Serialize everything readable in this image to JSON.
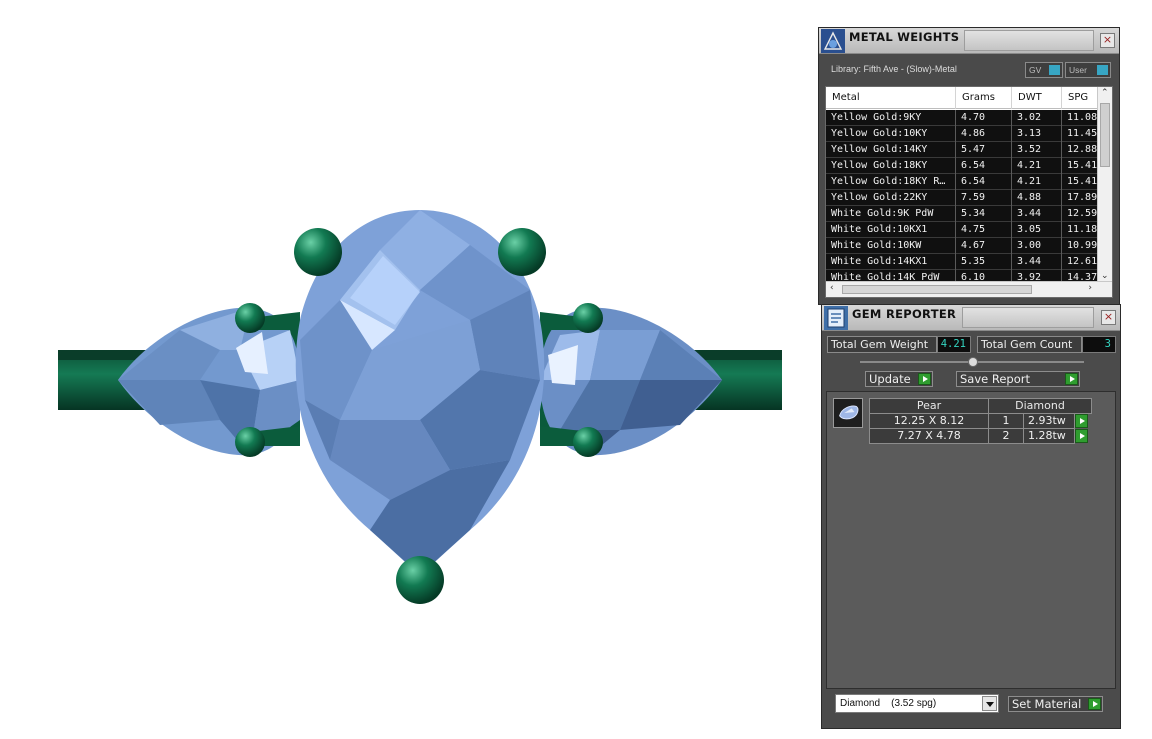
{
  "viewport": {
    "colors": {
      "gem": "#7fa2d8",
      "metal": "#0f6a48"
    }
  },
  "metal_weights": {
    "title": "METAL WEIGHTS",
    "library": "Library: Fifth Ave - (Slow)-Metal",
    "toggle_gv": "GV",
    "toggle_user": "User",
    "columns": [
      "Metal",
      "Grams",
      "DWT",
      "SPG"
    ],
    "rows": [
      [
        "Yellow Gold:9KY",
        "4.70",
        "3.02",
        "11.08"
      ],
      [
        "Yellow Gold:10KY",
        "4.86",
        "3.13",
        "11.45"
      ],
      [
        "Yellow Gold:14KY",
        "5.47",
        "3.52",
        "12.88"
      ],
      [
        "Yellow Gold:18KY",
        "6.54",
        "4.21",
        "15.41"
      ],
      [
        "Yellow Gold:18KY R…",
        "6.54",
        "4.21",
        "15.41"
      ],
      [
        "Yellow Gold:22KY",
        "7.59",
        "4.88",
        "17.89"
      ],
      [
        "White Gold:9K PdW",
        "5.34",
        "3.44",
        "12.59"
      ],
      [
        "White Gold:10KX1",
        "4.75",
        "3.05",
        "11.18"
      ],
      [
        "White Gold:10KW",
        "4.67",
        "3.00",
        "10.99"
      ],
      [
        "White Gold:14KX1",
        "5.35",
        "3.44",
        "12.61"
      ],
      [
        "White Gold:14K PdW",
        "6.10",
        "3.92",
        "14.37"
      ]
    ]
  },
  "gem_reporter": {
    "title": "GEM REPORTER",
    "total_weight_label": "Total Gem Weight",
    "total_weight_value": "4.21",
    "total_count_label": "Total Gem Count",
    "total_count_value": "3",
    "update_label": "Update",
    "save_report_label": "Save Report",
    "table_headers": [
      "Pear",
      "Diamond"
    ],
    "gems": [
      {
        "size": "12.25 X 8.12",
        "qty": "1",
        "weight": "2.93tw"
      },
      {
        "size": "7.27 X 4.78",
        "qty": "2",
        "weight": "1.28tw"
      }
    ],
    "material_select": "Diamond    (3.52 spg)",
    "set_material_label": "Set Material"
  }
}
